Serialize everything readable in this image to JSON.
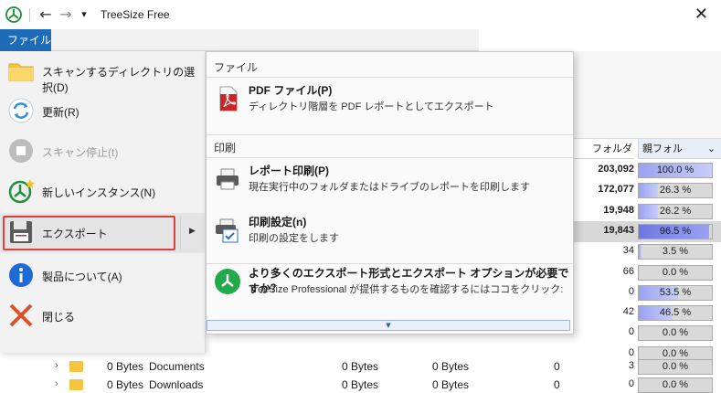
{
  "window": {
    "title": "TreeSize Free",
    "close_glyph": "✕"
  },
  "menubar": {
    "file_tab": "ファイル"
  },
  "file_menu": {
    "items": [
      {
        "label": "スキャンするディレクトリの選択(D)",
        "icon": "folder-icon",
        "enabled": true
      },
      {
        "label": "更新(R)",
        "icon": "refresh-icon",
        "enabled": true
      },
      {
        "label": "スキャン停止(t)",
        "icon": "stop-icon",
        "enabled": false
      },
      {
        "label": "新しいインスタンス(N)",
        "icon": "new-instance-icon",
        "enabled": true
      },
      {
        "label": "エクスポート",
        "icon": "floppy-icon",
        "enabled": true,
        "selected": true,
        "has_submenu": true
      },
      {
        "label": "製品について(A)",
        "icon": "info-icon",
        "enabled": true
      },
      {
        "label": "閉じる",
        "icon": "close-x-icon",
        "enabled": true
      }
    ]
  },
  "submenu": {
    "section_file": "ファイル",
    "section_print": "印刷",
    "items": [
      {
        "title": "PDF ファイル(P)",
        "desc": "ディレクトリ階層を PDF レポートとしてエクスポート",
        "icon": "pdf-icon"
      },
      {
        "title": "レポート印刷(P)",
        "desc": "現在実行中のフォルダまたはドライブのレポートを印刷します",
        "icon": "printer-icon"
      },
      {
        "title": "印刷設定(n)",
        "desc": "印刷の設定をします",
        "icon": "print-settings-icon"
      },
      {
        "title": "より多くのエクスポート形式とエクスポート オプションが必要ですか？",
        "desc": "TreeSize Professional が提供するものを確認するにはココをクリック:",
        "icon": "treesize-pro-icon"
      }
    ],
    "more_glyph": "▼"
  },
  "table": {
    "headers": {
      "folders": "フォルダ",
      "parent_pct": "親フォルダ...",
      "sort_glyph": "⌄"
    },
    "rows": [
      {
        "folders": "203,092",
        "pct": "100.0 %",
        "fill": 1.0,
        "bold": true
      },
      {
        "folders": "172,077",
        "pct": "26.3 %",
        "fill": 0.263,
        "bold": true
      },
      {
        "folders": "19,948",
        "pct": "26.2 %",
        "fill": 0.262,
        "bold": true
      },
      {
        "folders": "19,843",
        "pct": "96.5 %",
        "fill": 0.965,
        "bold": true,
        "selected": true
      },
      {
        "folders": "34",
        "pct": "3.5 %",
        "fill": 0.035,
        "bold": false
      },
      {
        "folders": "66",
        "pct": "0.0 %",
        "fill": 0.0,
        "bold": false
      },
      {
        "folders": "0",
        "pct": "53.5 %",
        "fill": 0.535,
        "bold": false
      },
      {
        "folders": "42",
        "pct": "46.5 %",
        "fill": 0.465,
        "bold": false
      },
      {
        "folders": "0",
        "pct": "0.0 %",
        "fill": 0.0,
        "bold": false
      },
      {
        "folders": "0",
        "pct": "0.0 %",
        "fill": 0.0,
        "bold": false
      }
    ]
  },
  "tree_rows": [
    {
      "size": "0 Bytes",
      "name": "Documents",
      "c3": "0 Bytes",
      "c4": "0 Bytes",
      "c5": "0",
      "folders": "3",
      "pct": "0.0 %"
    },
    {
      "size": "0 Bytes",
      "name": "Downloads",
      "c3": "0 Bytes",
      "c4": "0 Bytes",
      "c5": "0",
      "folders": "0",
      "pct": "0.0 %"
    }
  ]
}
